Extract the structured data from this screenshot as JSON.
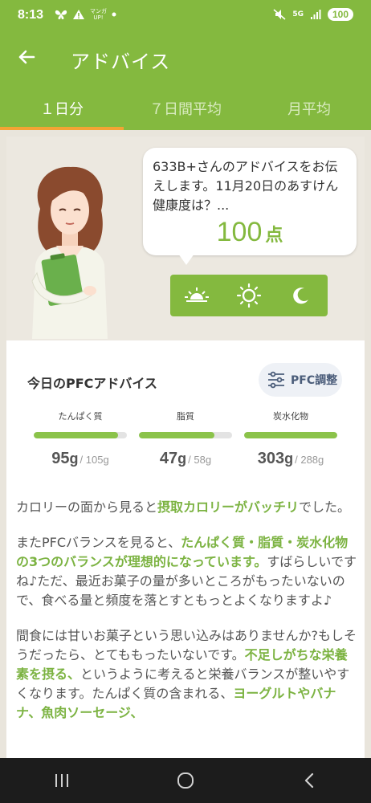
{
  "status": {
    "time": "8:13",
    "left_icons": [
      "butterfly-icon",
      "warning-icon",
      "manga-app-icon",
      "dot-icon"
    ],
    "manga_label_top": "マンガ",
    "manga_label_bottom": "UP!",
    "network": "5G",
    "battery": "100"
  },
  "app_bar": {
    "title": "アドバイス",
    "back_icon": "arrow-left-icon"
  },
  "tabs": [
    {
      "label": "１日分",
      "active": true
    },
    {
      "label": "７日間平均",
      "active": false
    },
    {
      "label": "月平均",
      "active": false
    }
  ],
  "advisor": {
    "message": "633B+さんのアドバイスをお伝えします。11月20日のあすけん健康度は？...",
    "score": "100",
    "score_unit": "点",
    "time_icons": [
      "sunrise-icon",
      "sun-icon",
      "moon-icon"
    ]
  },
  "pfc": {
    "title": "今日のPFCアドバイス",
    "adjust_label": "PFC調整",
    "nutrients": [
      {
        "label": "たんぱく質",
        "value": "95",
        "unit": "g",
        "target": "/ 105g",
        "fill": 0.905
      },
      {
        "label": "脂質",
        "value": "47",
        "unit": "g",
        "target": "/ 58g",
        "fill": 0.81
      },
      {
        "label": "炭水化物",
        "value": "303",
        "unit": "g",
        "target": "/ 288g",
        "fill": 1.0
      }
    ]
  },
  "advice": {
    "p1_pre": "カロリーの面から見ると",
    "p1_hl": "摂取カロリーがバッチリ",
    "p1_post": "でした。",
    "p2_pre": "またPFCバランスを見ると、",
    "p2_hl": "たんぱく質・脂質・炭水化物の3つのバランスが理想的になっています。",
    "p2_post": "すばらしいですね♪ただ、最近お菓子の量が多いところがもったいないので、食べる量と頻度を落とすともっとよくなりますよ♪",
    "p3_pre": "間食には甘いお菓子という思い込みはありませんか?もしそうだったら、とてももったいないです。",
    "p3_hl1": "不足しがちな栄養素を摂る、",
    "p3_mid": "というように考えると栄養バランスが整いやすくなります。たんぱく質の含まれる、",
    "p3_hl2": "ヨーグルトやバナナ、魚肉ソーセージ、",
    "p3_post": ""
  },
  "nav": {
    "icons": [
      "recent-apps-icon",
      "home-icon",
      "back-nav-icon"
    ]
  }
}
